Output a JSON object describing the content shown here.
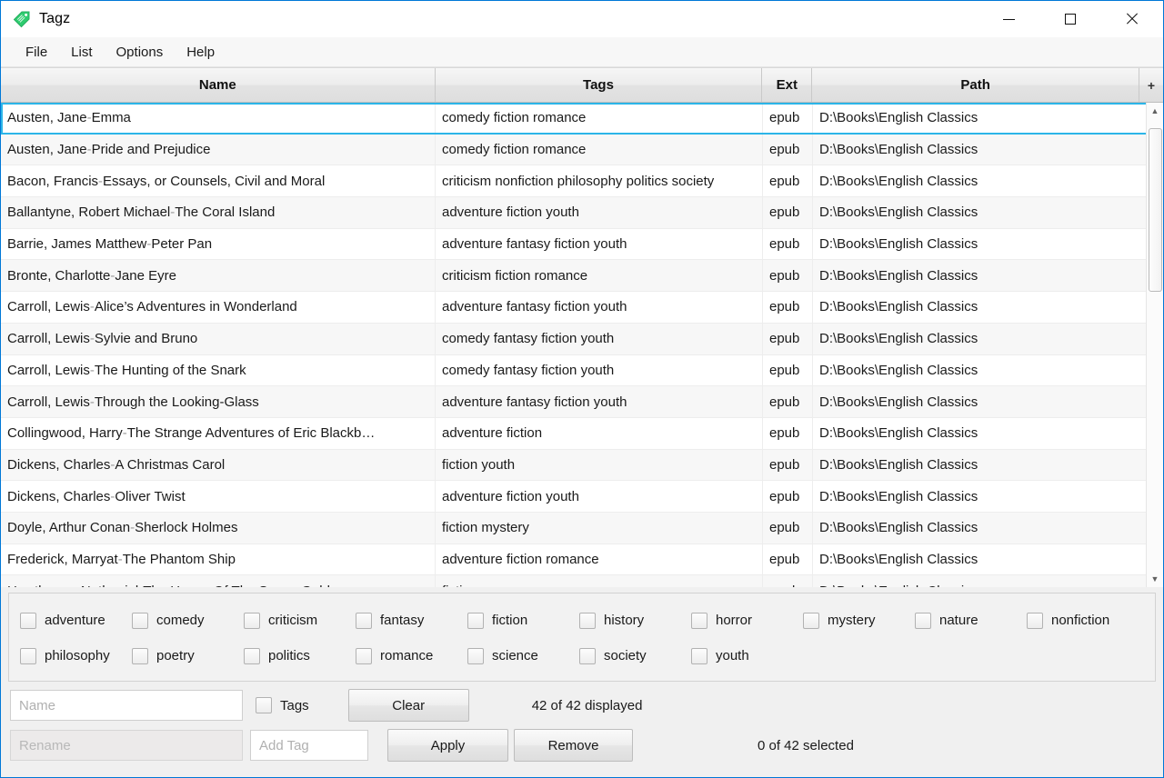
{
  "window": {
    "title": "Tagz",
    "icon": "tag-icon",
    "accent_color": "#0078d7",
    "controls": {
      "minimize": "–",
      "maximize": "□",
      "close": "✕"
    }
  },
  "menubar": {
    "items": [
      "File",
      "List",
      "Options",
      "Help"
    ]
  },
  "table": {
    "columns": [
      "Name",
      "Tags",
      "Ext",
      "Path"
    ],
    "add_column_label": "+",
    "focused_row_index": 0,
    "rows": [
      {
        "author": "Austen, Jane",
        "title": "Emma",
        "tags": "comedy fiction romance",
        "ext": "epub",
        "path": "D:\\Books\\English Classics"
      },
      {
        "author": "Austen, Jane",
        "title": "Pride and Prejudice",
        "tags": "comedy fiction romance",
        "ext": "epub",
        "path": "D:\\Books\\English Classics"
      },
      {
        "author": "Bacon, Francis",
        "title": "Essays, or Counsels, Civil and Moral",
        "tags": "criticism nonfiction philosophy politics society",
        "ext": "epub",
        "path": "D:\\Books\\English Classics"
      },
      {
        "author": "Ballantyne, Robert Michael",
        "title": "The Coral Island",
        "tags": "adventure fiction youth",
        "ext": "epub",
        "path": "D:\\Books\\English Classics"
      },
      {
        "author": "Barrie, James Matthew",
        "title": "Peter Pan",
        "tags": "adventure fantasy fiction youth",
        "ext": "epub",
        "path": "D:\\Books\\English Classics"
      },
      {
        "author": "Bronte, Charlotte",
        "title": "Jane Eyre",
        "tags": "criticism fiction romance",
        "ext": "epub",
        "path": "D:\\Books\\English Classics"
      },
      {
        "author": "Carroll, Lewis ",
        "title": "Alice’s Adventures in Wonderland",
        "tags": "adventure fantasy fiction youth",
        "ext": "epub",
        "path": "D:\\Books\\English Classics"
      },
      {
        "author": "Carroll, Lewis ",
        "title": "Sylvie and Bruno",
        "tags": "comedy fantasy fiction youth",
        "ext": "epub",
        "path": "D:\\Books\\English Classics"
      },
      {
        "author": "Carroll, Lewis ",
        "title": "The Hunting of the Snark",
        "tags": "comedy fantasy fiction youth",
        "ext": "epub",
        "path": "D:\\Books\\English Classics"
      },
      {
        "author": "Carroll, Lewis ",
        "title": "Through the Looking-Glass",
        "tags": "adventure fantasy fiction youth",
        "ext": "epub",
        "path": "D:\\Books\\English Classics"
      },
      {
        "author": "Collingwood, Harry",
        "title": "The Strange Adventures of Eric Blackb…",
        "tags": "adventure fiction",
        "ext": "epub",
        "path": "D:\\Books\\English Classics"
      },
      {
        "author": "Dickens, Charles",
        "title": "A Christmas Carol",
        "tags": "fiction youth",
        "ext": "epub",
        "path": "D:\\Books\\English Classics"
      },
      {
        "author": "Dickens, Charles",
        "title": "Oliver Twist",
        "tags": "adventure fiction youth",
        "ext": "epub",
        "path": "D:\\Books\\English Classics"
      },
      {
        "author": "Doyle, Arthur Conan",
        "title": "Sherlock Holmes",
        "tags": "fiction mystery",
        "ext": "epub",
        "path": "D:\\Books\\English Classics"
      },
      {
        "author": "Frederick, Marryat",
        "title": "The Phantom Ship",
        "tags": "adventure fiction romance",
        "ext": "epub",
        "path": "D:\\Books\\English Classics"
      },
      {
        "author": "Hawthorne, Nathaniel ",
        "title": "The House Of The Seven Gables",
        "tags": "fiction romance",
        "ext": "epub",
        "path": "D:\\Books\\English Classics"
      }
    ],
    "separator": " - "
  },
  "tag_filter": {
    "row1": [
      "adventure",
      "comedy",
      "criticism",
      "fantasy",
      "fiction",
      "history",
      "horror",
      "mystery",
      "nature",
      "nonfiction"
    ],
    "row2": [
      "philosophy",
      "poetry",
      "politics",
      "romance",
      "science",
      "society",
      "youth"
    ]
  },
  "controls": {
    "name_placeholder": "Name",
    "name_value": "",
    "rename_placeholder": "Rename",
    "rename_value": "",
    "addtag_placeholder": "Add Tag",
    "addtag_value": "",
    "tags_checkbox_label": "Tags",
    "clear_label": "Clear",
    "apply_label": "Apply",
    "remove_label": "Remove",
    "displayed_status": "42 of 42 displayed",
    "selected_status": "0 of 42 selected"
  }
}
